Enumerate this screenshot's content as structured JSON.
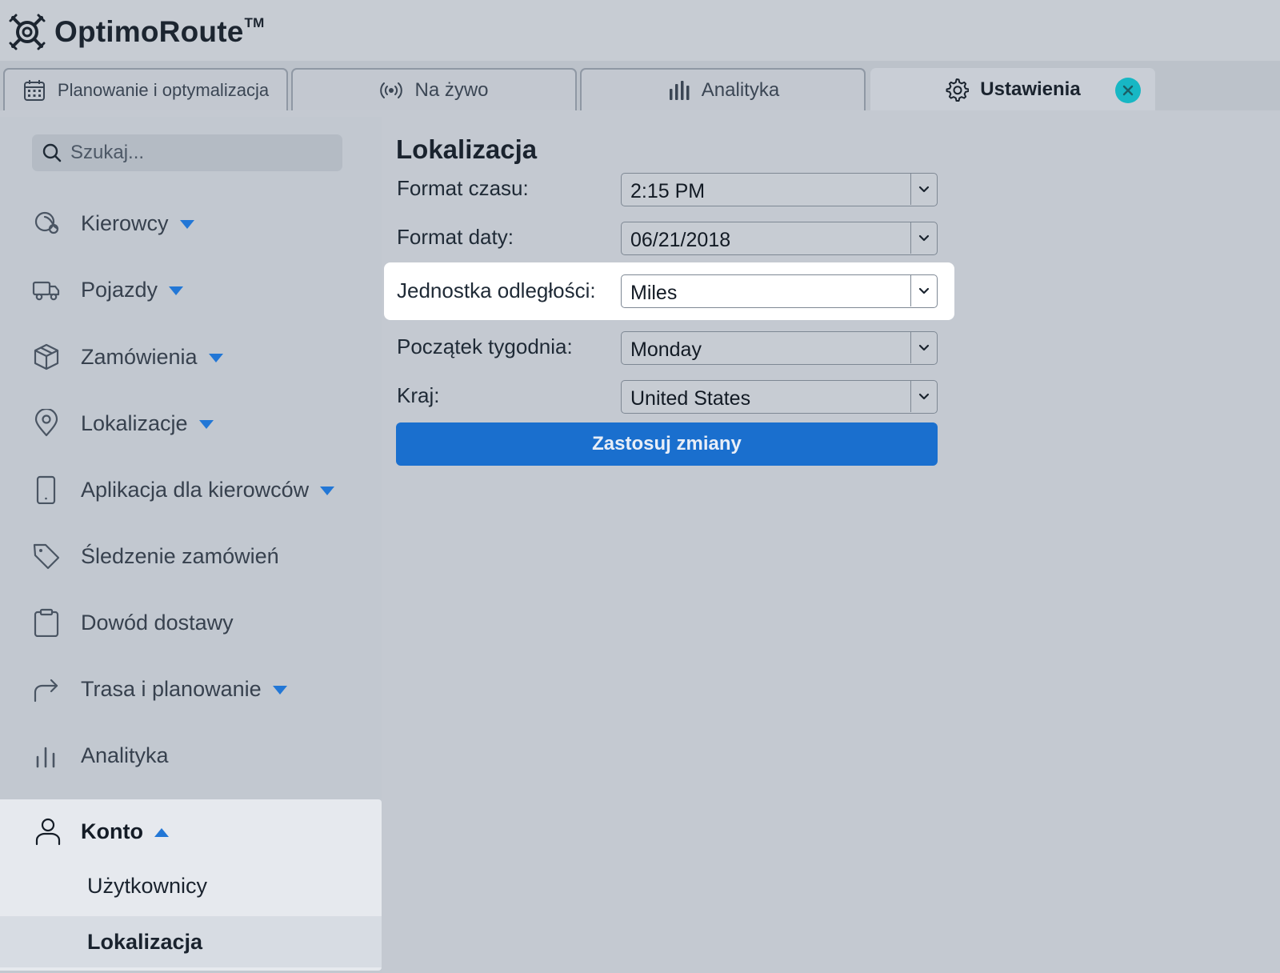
{
  "app": {
    "logo_text": "OptimoRoute",
    "logo_tm": "TM"
  },
  "tabs": [
    {
      "label": "Planowanie i optymalizacja",
      "icon": "calendar-icon"
    },
    {
      "label": "Na żywo",
      "icon": "live-signal-icon"
    },
    {
      "label": "Analityka",
      "icon": "bar-chart-icon"
    },
    {
      "label": "Ustawienia",
      "icon": "gear-icon",
      "active": true
    }
  ],
  "sidebar": {
    "search_placeholder": "Szukaj...",
    "items": [
      {
        "label": "Kierowcy",
        "icon": "drivers-icon",
        "caret": "down"
      },
      {
        "label": "Pojazdy",
        "icon": "truck-icon",
        "caret": "down"
      },
      {
        "label": "Zamówienia",
        "icon": "package-icon",
        "caret": "down"
      },
      {
        "label": "Lokalizacje",
        "icon": "location-pin-icon",
        "caret": "down"
      },
      {
        "label": "Aplikacja dla kierowców",
        "icon": "phone-icon",
        "caret": "down"
      },
      {
        "label": "Śledzenie zamówień",
        "icon": "tag-icon"
      },
      {
        "label": "Dowód dostawy",
        "icon": "clipboard-icon"
      },
      {
        "label": "Trasa i planowanie",
        "icon": "route-arrow-icon",
        "caret": "down"
      },
      {
        "label": "Analityka",
        "icon": "bar-chart-icon"
      }
    ],
    "account": {
      "label": "Konto",
      "icon": "user-icon",
      "caret": "up",
      "subitems": [
        {
          "label": "Użytkownicy"
        },
        {
          "label": "Lokalizacja",
          "selected": true
        }
      ]
    }
  },
  "main": {
    "title": "Lokalizacja",
    "fields": [
      {
        "label": "Format czasu:",
        "value": "2:15 PM"
      },
      {
        "label": "Format daty:",
        "value": "06/21/2018"
      },
      {
        "label": "Jednostka odległości:",
        "value": "Miles",
        "highlighted": true
      },
      {
        "label": "Początek tygodnia:",
        "value": "Monday"
      },
      {
        "label": "Kraj:",
        "value": "United States"
      }
    ],
    "apply_label": "Zastosuj zmiany"
  },
  "colors": {
    "accent": "#1a6fce",
    "caret": "#2277d6",
    "close_badge": "#17b7c4",
    "background": "#c4c9d1"
  }
}
